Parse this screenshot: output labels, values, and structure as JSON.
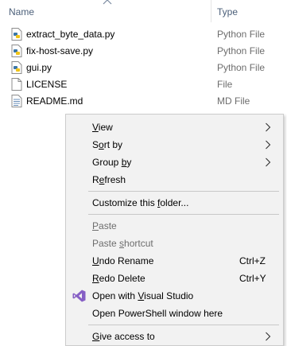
{
  "header": {
    "name_col": "Name",
    "type_col": "Type"
  },
  "files": [
    {
      "name": "extract_byte_data.py",
      "type": "Python File",
      "icon": "python-file-icon"
    },
    {
      "name": "fix-host-save.py",
      "type": "Python File",
      "icon": "python-file-icon"
    },
    {
      "name": "gui.py",
      "type": "Python File",
      "icon": "python-file-icon"
    },
    {
      "name": "LICENSE",
      "type": "File",
      "icon": "blank-file-icon"
    },
    {
      "name": "README.md",
      "type": "MD File",
      "icon": "md-file-icon"
    }
  ],
  "menu": {
    "view": {
      "pre": "",
      "acc": "V",
      "post": "iew"
    },
    "sort_by": {
      "pre": "S",
      "acc": "o",
      "post": "rt by"
    },
    "group_by": {
      "pre": "Group ",
      "acc": "b",
      "post": "y"
    },
    "refresh": {
      "pre": "R",
      "acc": "e",
      "post": "fresh"
    },
    "customize": {
      "pre": "Customize this ",
      "acc": "f",
      "post": "older..."
    },
    "paste": {
      "pre": "",
      "acc": "P",
      "post": "aste"
    },
    "paste_shortcut": {
      "pre": "Paste ",
      "acc": "s",
      "post": "hortcut"
    },
    "undo_rename": {
      "pre": "",
      "acc": "U",
      "post": "ndo Rename",
      "shortcut": "Ctrl+Z"
    },
    "redo_delete": {
      "pre": "",
      "acc": "R",
      "post": "edo Delete",
      "shortcut": "Ctrl+Y"
    },
    "open_vs": {
      "pre": "Open with ",
      "acc": "V",
      "post": "isual Studio"
    },
    "open_powershell": {
      "pre": "Open PowerShell window here",
      "acc": "",
      "post": ""
    },
    "give_access": {
      "pre": "",
      "acc": "G",
      "post": "ive access to"
    }
  },
  "colors": {
    "menu_bg": "#f2f2f2",
    "header_text": "#4c607a",
    "disabled_text": "#6d6d6d",
    "vs_purple": "#865fc5"
  }
}
